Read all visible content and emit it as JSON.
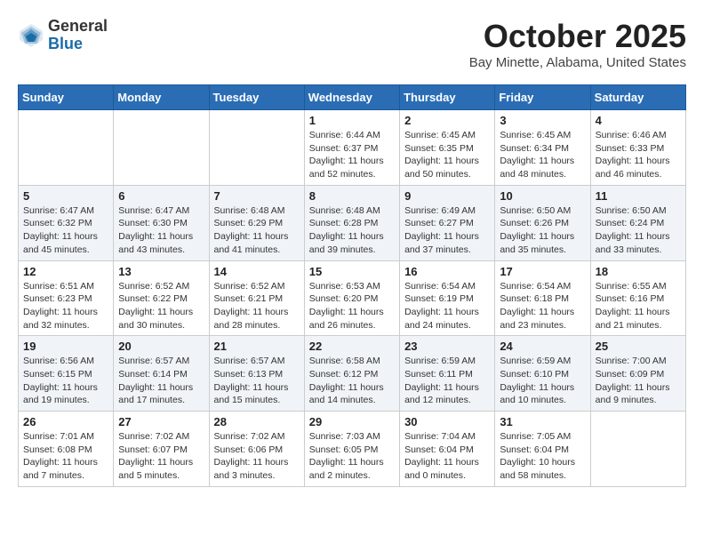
{
  "header": {
    "logo": {
      "general": "General",
      "blue": "Blue"
    },
    "title": "October 2025",
    "location": "Bay Minette, Alabama, United States"
  },
  "weekdays": [
    "Sunday",
    "Monday",
    "Tuesday",
    "Wednesday",
    "Thursday",
    "Friday",
    "Saturday"
  ],
  "weeks": [
    [
      {
        "day": "",
        "info": ""
      },
      {
        "day": "",
        "info": ""
      },
      {
        "day": "",
        "info": ""
      },
      {
        "day": "1",
        "sunrise": "Sunrise: 6:44 AM",
        "sunset": "Sunset: 6:37 PM",
        "daylight": "Daylight: 11 hours and 52 minutes."
      },
      {
        "day": "2",
        "sunrise": "Sunrise: 6:45 AM",
        "sunset": "Sunset: 6:35 PM",
        "daylight": "Daylight: 11 hours and 50 minutes."
      },
      {
        "day": "3",
        "sunrise": "Sunrise: 6:45 AM",
        "sunset": "Sunset: 6:34 PM",
        "daylight": "Daylight: 11 hours and 48 minutes."
      },
      {
        "day": "4",
        "sunrise": "Sunrise: 6:46 AM",
        "sunset": "Sunset: 6:33 PM",
        "daylight": "Daylight: 11 hours and 46 minutes."
      }
    ],
    [
      {
        "day": "5",
        "sunrise": "Sunrise: 6:47 AM",
        "sunset": "Sunset: 6:32 PM",
        "daylight": "Daylight: 11 hours and 45 minutes."
      },
      {
        "day": "6",
        "sunrise": "Sunrise: 6:47 AM",
        "sunset": "Sunset: 6:30 PM",
        "daylight": "Daylight: 11 hours and 43 minutes."
      },
      {
        "day": "7",
        "sunrise": "Sunrise: 6:48 AM",
        "sunset": "Sunset: 6:29 PM",
        "daylight": "Daylight: 11 hours and 41 minutes."
      },
      {
        "day": "8",
        "sunrise": "Sunrise: 6:48 AM",
        "sunset": "Sunset: 6:28 PM",
        "daylight": "Daylight: 11 hours and 39 minutes."
      },
      {
        "day": "9",
        "sunrise": "Sunrise: 6:49 AM",
        "sunset": "Sunset: 6:27 PM",
        "daylight": "Daylight: 11 hours and 37 minutes."
      },
      {
        "day": "10",
        "sunrise": "Sunrise: 6:50 AM",
        "sunset": "Sunset: 6:26 PM",
        "daylight": "Daylight: 11 hours and 35 minutes."
      },
      {
        "day": "11",
        "sunrise": "Sunrise: 6:50 AM",
        "sunset": "Sunset: 6:24 PM",
        "daylight": "Daylight: 11 hours and 33 minutes."
      }
    ],
    [
      {
        "day": "12",
        "sunrise": "Sunrise: 6:51 AM",
        "sunset": "Sunset: 6:23 PM",
        "daylight": "Daylight: 11 hours and 32 minutes."
      },
      {
        "day": "13",
        "sunrise": "Sunrise: 6:52 AM",
        "sunset": "Sunset: 6:22 PM",
        "daylight": "Daylight: 11 hours and 30 minutes."
      },
      {
        "day": "14",
        "sunrise": "Sunrise: 6:52 AM",
        "sunset": "Sunset: 6:21 PM",
        "daylight": "Daylight: 11 hours and 28 minutes."
      },
      {
        "day": "15",
        "sunrise": "Sunrise: 6:53 AM",
        "sunset": "Sunset: 6:20 PM",
        "daylight": "Daylight: 11 hours and 26 minutes."
      },
      {
        "day": "16",
        "sunrise": "Sunrise: 6:54 AM",
        "sunset": "Sunset: 6:19 PM",
        "daylight": "Daylight: 11 hours and 24 minutes."
      },
      {
        "day": "17",
        "sunrise": "Sunrise: 6:54 AM",
        "sunset": "Sunset: 6:18 PM",
        "daylight": "Daylight: 11 hours and 23 minutes."
      },
      {
        "day": "18",
        "sunrise": "Sunrise: 6:55 AM",
        "sunset": "Sunset: 6:16 PM",
        "daylight": "Daylight: 11 hours and 21 minutes."
      }
    ],
    [
      {
        "day": "19",
        "sunrise": "Sunrise: 6:56 AM",
        "sunset": "Sunset: 6:15 PM",
        "daylight": "Daylight: 11 hours and 19 minutes."
      },
      {
        "day": "20",
        "sunrise": "Sunrise: 6:57 AM",
        "sunset": "Sunset: 6:14 PM",
        "daylight": "Daylight: 11 hours and 17 minutes."
      },
      {
        "day": "21",
        "sunrise": "Sunrise: 6:57 AM",
        "sunset": "Sunset: 6:13 PM",
        "daylight": "Daylight: 11 hours and 15 minutes."
      },
      {
        "day": "22",
        "sunrise": "Sunrise: 6:58 AM",
        "sunset": "Sunset: 6:12 PM",
        "daylight": "Daylight: 11 hours and 14 minutes."
      },
      {
        "day": "23",
        "sunrise": "Sunrise: 6:59 AM",
        "sunset": "Sunset: 6:11 PM",
        "daylight": "Daylight: 11 hours and 12 minutes."
      },
      {
        "day": "24",
        "sunrise": "Sunrise: 6:59 AM",
        "sunset": "Sunset: 6:10 PM",
        "daylight": "Daylight: 11 hours and 10 minutes."
      },
      {
        "day": "25",
        "sunrise": "Sunrise: 7:00 AM",
        "sunset": "Sunset: 6:09 PM",
        "daylight": "Daylight: 11 hours and 9 minutes."
      }
    ],
    [
      {
        "day": "26",
        "sunrise": "Sunrise: 7:01 AM",
        "sunset": "Sunset: 6:08 PM",
        "daylight": "Daylight: 11 hours and 7 minutes."
      },
      {
        "day": "27",
        "sunrise": "Sunrise: 7:02 AM",
        "sunset": "Sunset: 6:07 PM",
        "daylight": "Daylight: 11 hours and 5 minutes."
      },
      {
        "day": "28",
        "sunrise": "Sunrise: 7:02 AM",
        "sunset": "Sunset: 6:06 PM",
        "daylight": "Daylight: 11 hours and 3 minutes."
      },
      {
        "day": "29",
        "sunrise": "Sunrise: 7:03 AM",
        "sunset": "Sunset: 6:05 PM",
        "daylight": "Daylight: 11 hours and 2 minutes."
      },
      {
        "day": "30",
        "sunrise": "Sunrise: 7:04 AM",
        "sunset": "Sunset: 6:04 PM",
        "daylight": "Daylight: 11 hours and 0 minutes."
      },
      {
        "day": "31",
        "sunrise": "Sunrise: 7:05 AM",
        "sunset": "Sunset: 6:04 PM",
        "daylight": "Daylight: 10 hours and 58 minutes."
      },
      {
        "day": "",
        "info": ""
      }
    ]
  ]
}
